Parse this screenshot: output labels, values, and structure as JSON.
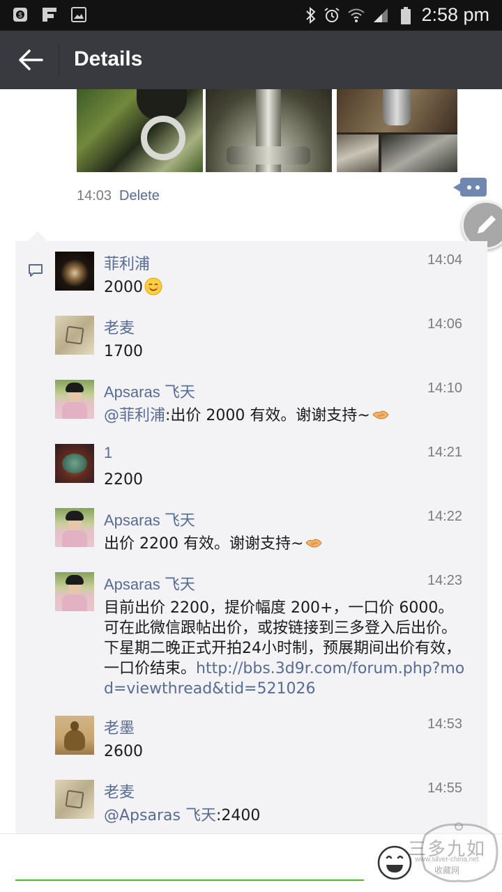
{
  "status_bar": {
    "time": "2:58 pm",
    "icons": [
      "s-notification-icon",
      "f-notification-icon",
      "image-notification-icon",
      "bluetooth-icon",
      "alarm-icon",
      "wifi-icon",
      "signal-icon",
      "battery-icon"
    ]
  },
  "header": {
    "title": "Details",
    "back_icon": "arrow-left-icon"
  },
  "post": {
    "time": "14:03",
    "delete_label": "Delete"
  },
  "comments": [
    {
      "name": "菲利浦",
      "time": "14:04",
      "text": "2000",
      "emoji": "smile"
    },
    {
      "name": "老麦",
      "time": "14:06",
      "text": "1700"
    },
    {
      "name": "Apsaras 飞天",
      "time": "14:10",
      "mention": "@菲利浦",
      "text": ":出价 2000 有效。谢谢支持~",
      "emoji": "handshake"
    },
    {
      "name": "1",
      "time": "14:21",
      "text": "2200"
    },
    {
      "name": "Apsaras 飞天",
      "time": "14:22",
      "text": "出价 2200 有效。谢谢支持~",
      "emoji": "handshake"
    },
    {
      "name": "Apsaras 飞天",
      "time": "14:23",
      "text": "目前出价 2200，提价幅度 200+，一口价 6000。可在此微信跟帖出价，或按链接到三多登入后出价。下星期二晚正式开拍24小时制，预展期间出价有效，一口价结束。",
      "link": "http://bbs.3d9r.com/forum.php?mod=viewthread&tid=521026"
    },
    {
      "name": "老墨",
      "time": "14:53",
      "text": "2600"
    },
    {
      "name": "老麦",
      "time": "14:55",
      "mention": "@Apsaras 飞天",
      "text": ":2400"
    }
  ],
  "input": {
    "placeholder": ""
  },
  "watermark": {
    "title": "三多九如",
    "url": "www.silver-china.net",
    "sub": "收藏网"
  },
  "colors": {
    "status_bar": "#121212",
    "app_bar": "#393a3f",
    "link": "#576b95",
    "panel": "#f3f3f5",
    "input_underline": "#45c01a"
  }
}
